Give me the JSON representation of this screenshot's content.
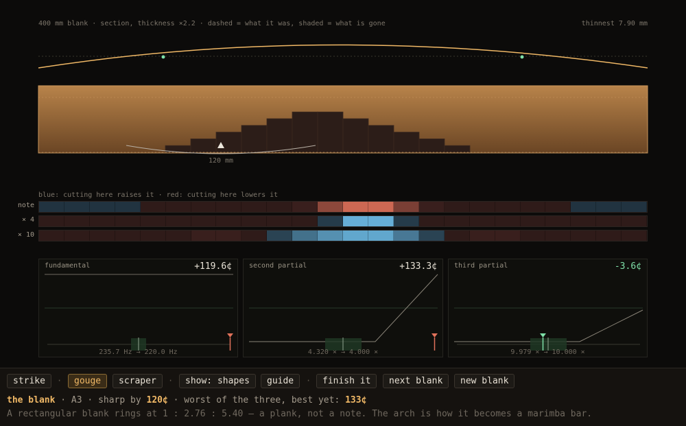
{
  "header": {
    "caption": "400 mm blank · section, thickness ×2.2 · dashed = what it was, shaded = what is gone",
    "thinnest": "thinnest 7.90 mm"
  },
  "section": {
    "marker_label": "120 mm",
    "steps": [
      0,
      0,
      0,
      0,
      0,
      1,
      2,
      3,
      4,
      5,
      6,
      6,
      5,
      4,
      3,
      2,
      1,
      0,
      0,
      0,
      0,
      0,
      0,
      0
    ]
  },
  "sensitivity": {
    "caption": "blue: cutting here raises it · red: cutting here lowers it",
    "rows": [
      {
        "label": "note",
        "values": [
          -0.15,
          -0.15,
          -0.15,
          -0.15,
          0.05,
          0.05,
          0.05,
          0.05,
          0.05,
          0.05,
          0.1,
          0.55,
          0.9,
          0.9,
          0.45,
          0.1,
          0.05,
          0.05,
          0.05,
          0.05,
          0.05,
          -0.15,
          -0.15,
          -0.15
        ]
      },
      {
        "label": "× 4",
        "values": [
          0.05,
          0.05,
          0.05,
          0.05,
          0.05,
          0.05,
          0.05,
          0.05,
          0.05,
          0.05,
          0.05,
          -0.2,
          -0.95,
          -0.95,
          -0.2,
          0.05,
          0.05,
          0.05,
          0.05,
          0.05,
          0.05,
          0.05,
          0.05,
          0.05
        ]
      },
      {
        "label": "× 10",
        "values": [
          0.05,
          0.05,
          0.05,
          0.05,
          0.05,
          0.05,
          0.1,
          0.1,
          0.05,
          -0.25,
          -0.55,
          -0.75,
          -0.9,
          -0.9,
          -0.6,
          -0.25,
          0.05,
          0.1,
          0.1,
          0.05,
          0.05,
          0.05,
          0.05,
          0.05
        ]
      }
    ]
  },
  "partials": [
    {
      "title": "fundamental",
      "value": "+119.6¢",
      "good": false,
      "range": "235.7 Hz → 220.0 Hz"
    },
    {
      "title": "second partial",
      "value": "+133.3¢",
      "good": false,
      "range": "4.320 × → 4.000 ×"
    },
    {
      "title": "third partial",
      "value": "-3.6¢",
      "good": true,
      "range": "9.979 × → 10.000 ×"
    }
  ],
  "toolbar": {
    "strike": "strike",
    "gouge": "gouge",
    "scraper": "scraper",
    "show_shapes": "show: shapes",
    "guide": "guide",
    "finish": "finish it",
    "next_blank": "next blank",
    "new_blank": "new blank",
    "sep": "·"
  },
  "status": {
    "prefix": "the blank",
    "mid": " · A3 · sharp by ",
    "sharp": "120¢",
    "mid2": " · worst of the three, best yet: ",
    "best": "133¢",
    "desc": "A rectangular blank rings at 1 : 2.76 : 5.40 — a plank, not a note. The arch is how it becomes a marimba bar."
  },
  "colors": {
    "wood_top": "#b8834a",
    "wood_bottom": "#6a4524",
    "cut": "#2c1d18",
    "amber": "#f0b866",
    "red": "#e0715a",
    "blue": "#6ab6e0",
    "good": "#7fe0a8"
  }
}
